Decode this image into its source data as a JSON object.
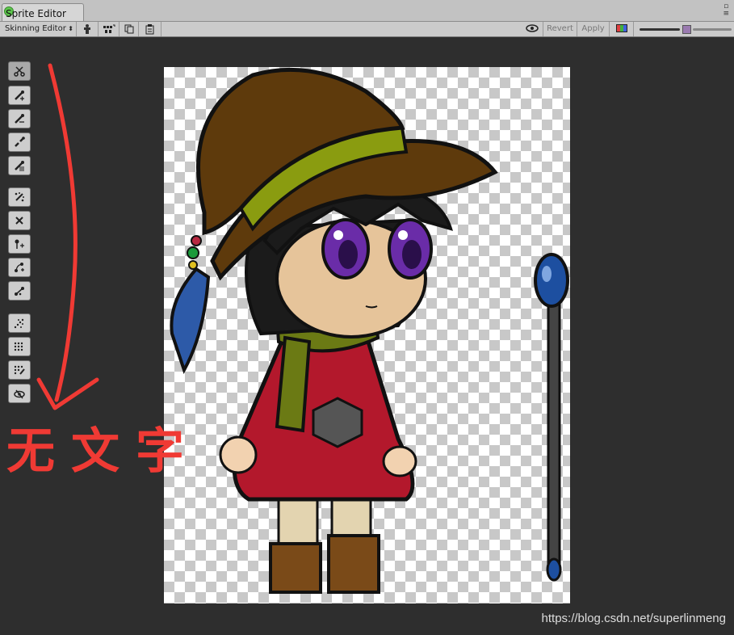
{
  "window": {
    "tab_title": "Sprite Editor"
  },
  "toolbar": {
    "mode_dropdown": "Skinning Editor",
    "revert_label": "Revert",
    "apply_label": "Apply"
  },
  "annotation": {
    "text": "无文字"
  },
  "watermark": "https://blog.csdn.net/superlinmeng",
  "colors": {
    "annotation_red": "#f03a34",
    "canvas_bg": "#2e2e2e"
  },
  "tool_icons": [
    "scissors-icon",
    "create-bone-icon",
    "edit-bone-icon",
    "split-bone-icon",
    "generate-geometry-icon",
    "auto-geometry-icon",
    "create-vertex-icon",
    "create-edge-icon",
    "split-edge-icon",
    "edit-geometry-icon",
    "weight-brush-icon",
    "weight-slider-icon",
    "auto-weights-icon",
    "visibility-icon"
  ]
}
